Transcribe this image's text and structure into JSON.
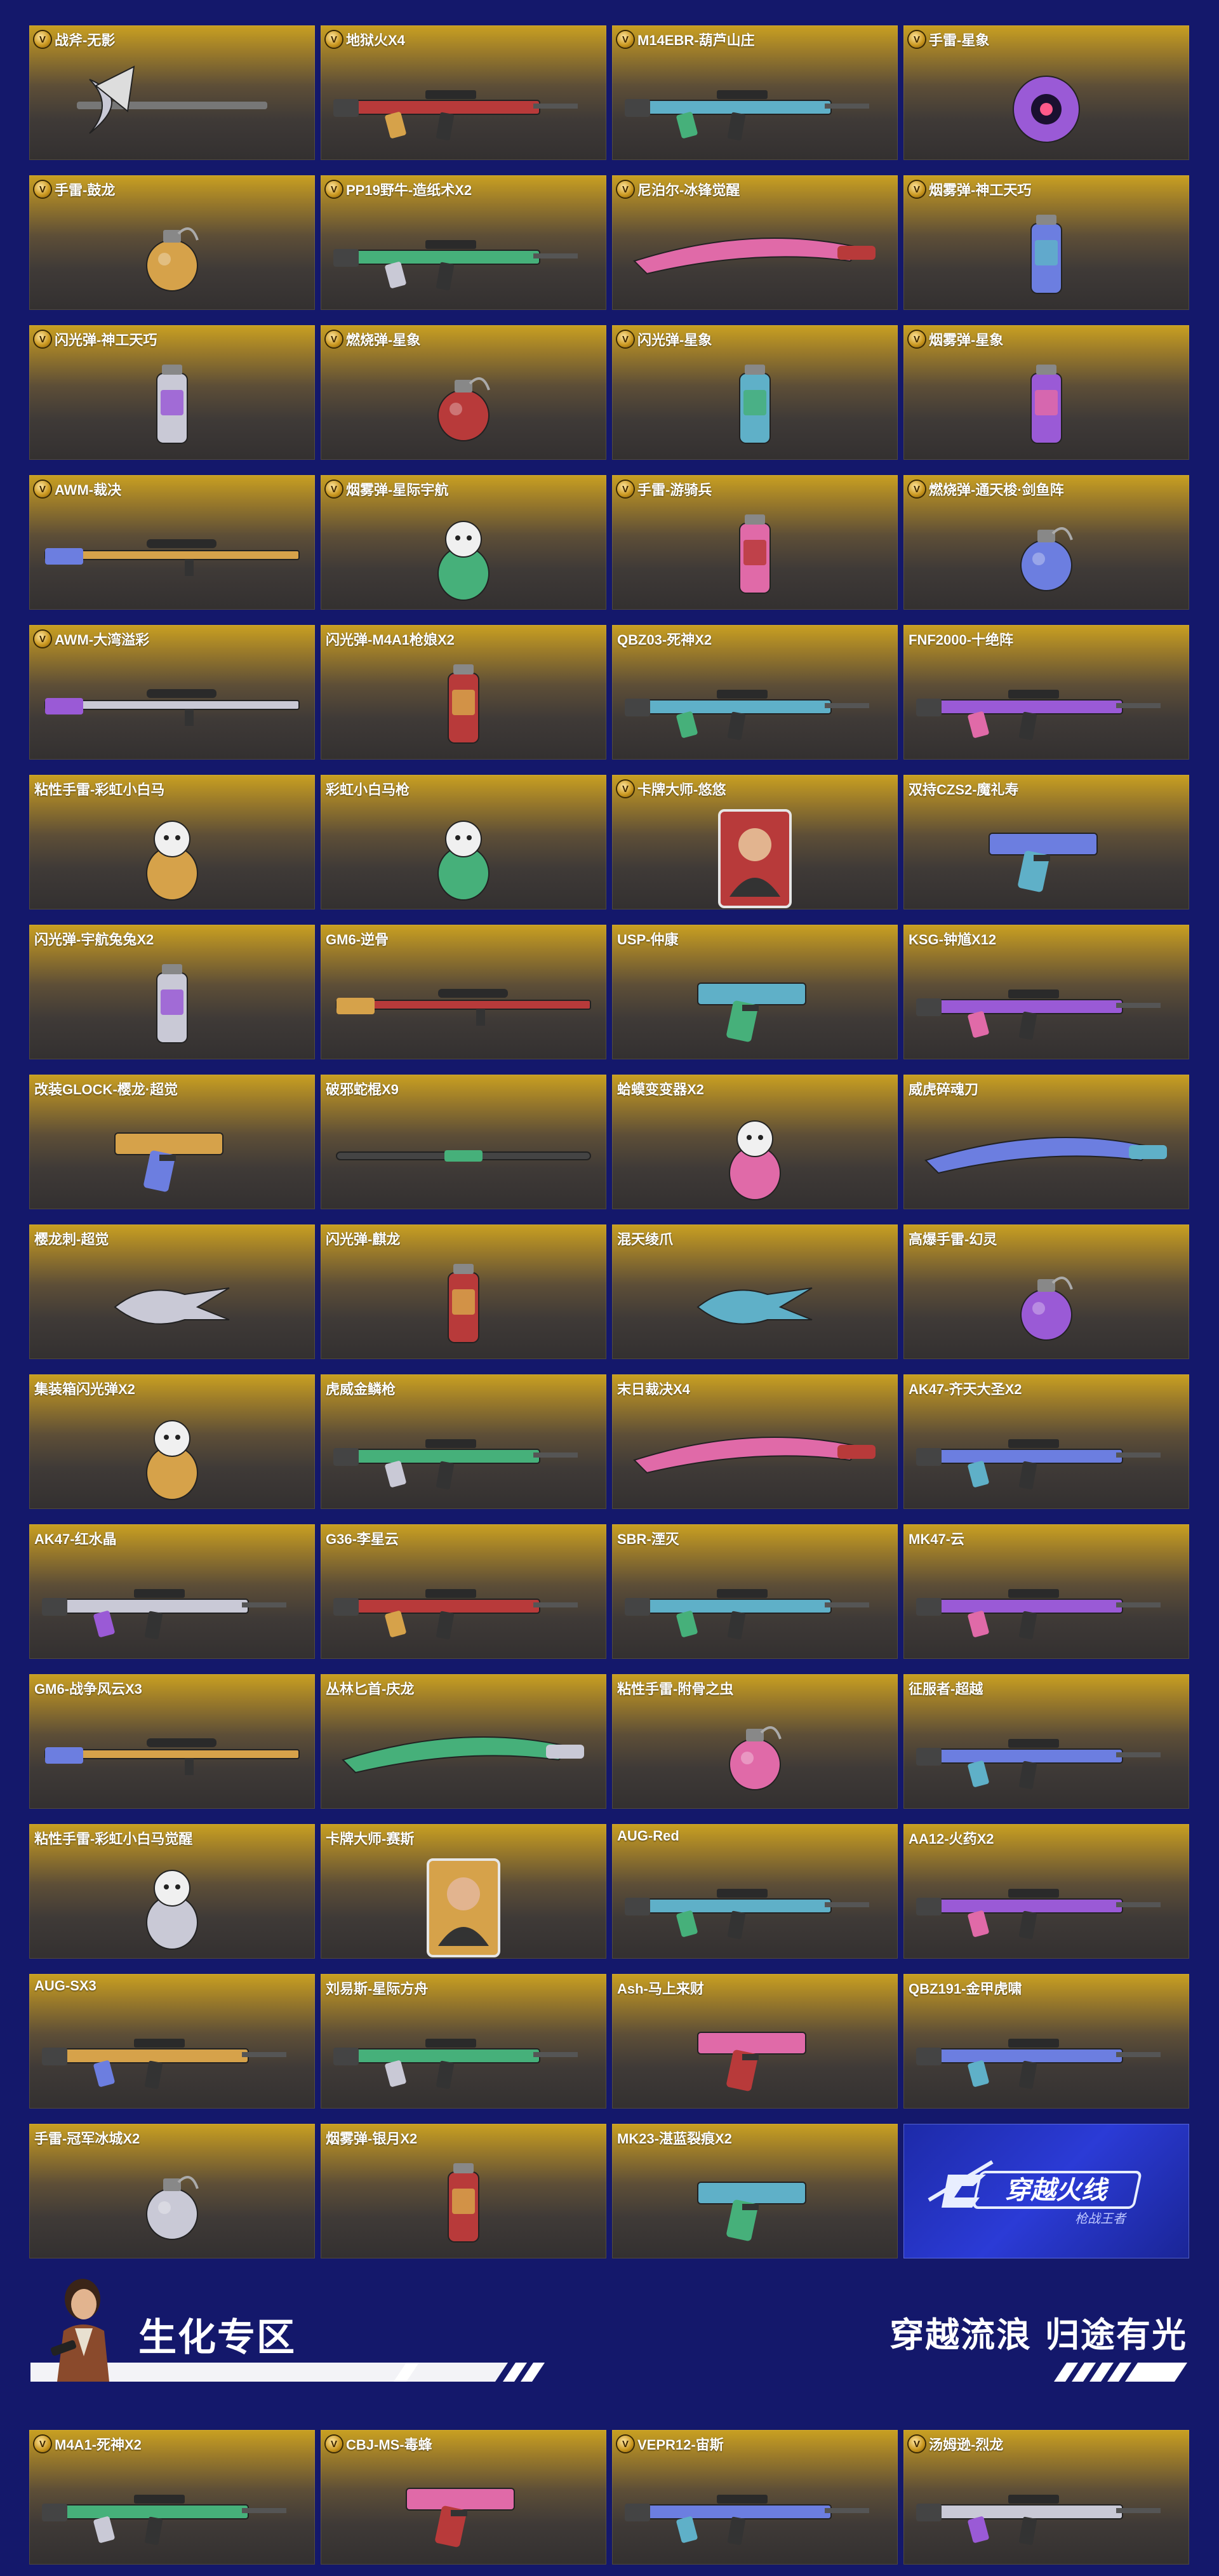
{
  "colors": {
    "background": "#14186b",
    "card_gold": "#c9a021",
    "card_dark": "#333030",
    "badge": "#c8951c"
  },
  "items": [
    {
      "name": "战斧-无影",
      "v": true,
      "icon": "axe"
    },
    {
      "name": "地狱火X4",
      "v": true,
      "icon": "rifle"
    },
    {
      "name": "M14EBR-葫芦山庄",
      "v": true,
      "icon": "rifle"
    },
    {
      "name": "手雷-星象",
      "v": true,
      "icon": "orb"
    },
    {
      "name": "手雷-鼓龙",
      "v": true,
      "icon": "grenade"
    },
    {
      "name": "PP19野牛-造纸术X2",
      "v": true,
      "icon": "rifle"
    },
    {
      "name": "尼泊尔-冰锋觉醒",
      "v": true,
      "icon": "knife"
    },
    {
      "name": "烟雾弹-神工天巧",
      "v": true,
      "icon": "canister"
    },
    {
      "name": "闪光弹-神工天巧",
      "v": true,
      "icon": "canister"
    },
    {
      "name": "燃烧弹-星象",
      "v": true,
      "icon": "grenade"
    },
    {
      "name": "闪光弹-星象",
      "v": true,
      "icon": "canister"
    },
    {
      "name": "烟雾弹-星象",
      "v": true,
      "icon": "canister"
    },
    {
      "name": "AWM-裁决",
      "v": true,
      "icon": "sniper"
    },
    {
      "name": "烟雾弹-星际宇航",
      "v": true,
      "icon": "figure"
    },
    {
      "name": "手雷-游骑兵",
      "v": true,
      "icon": "canister"
    },
    {
      "name": "燃烧弹-通天梭·剑鱼阵",
      "v": true,
      "icon": "grenade"
    },
    {
      "name": "AWM-大湾溢彩",
      "v": true,
      "icon": "sniper"
    },
    {
      "name": "闪光弹-M4A1枪娘X2",
      "v": false,
      "icon": "canister"
    },
    {
      "name": "QBZ03-死神X2",
      "v": false,
      "icon": "rifle"
    },
    {
      "name": "FNF2000-十绝阵",
      "v": false,
      "icon": "rifle"
    },
    {
      "name": "粘性手雷-彩虹小白马",
      "v": false,
      "icon": "figure"
    },
    {
      "name": "彩虹小白马枪",
      "v": false,
      "icon": "figure"
    },
    {
      "name": "卡牌大师-悠悠",
      "v": true,
      "icon": "card"
    },
    {
      "name": "双持CZS2-魔礼寿",
      "v": false,
      "icon": "pistol"
    },
    {
      "name": "闪光弹-宇航兔兔X2",
      "v": false,
      "icon": "canister"
    },
    {
      "name": "GM6-逆骨",
      "v": false,
      "icon": "sniper"
    },
    {
      "name": "USP-仲康",
      "v": false,
      "icon": "pistol"
    },
    {
      "name": "KSG-钟馗X12",
      "v": false,
      "icon": "rifle"
    },
    {
      "name": "改装GLOCK-樱龙·超觉",
      "v": false,
      "icon": "pistol"
    },
    {
      "name": "破邪蛇棍X9",
      "v": false,
      "icon": "staff"
    },
    {
      "name": "蛤蟆变变器X2",
      "v": false,
      "icon": "figure"
    },
    {
      "name": "威虎碎魂刀",
      "v": false,
      "icon": "knife"
    },
    {
      "name": "樱龙刺-超觉",
      "v": false,
      "icon": "claw"
    },
    {
      "name": "闪光弹-麒龙",
      "v": false,
      "icon": "canister"
    },
    {
      "name": "混天绫爪",
      "v": false,
      "icon": "claw"
    },
    {
      "name": "高爆手雷-幻灵",
      "v": false,
      "icon": "grenade"
    },
    {
      "name": "集装箱闪光弹X2",
      "v": false,
      "icon": "figure"
    },
    {
      "name": "虎威金鳞枪",
      "v": false,
      "icon": "rifle"
    },
    {
      "name": "末日裁决X4",
      "v": false,
      "icon": "knife"
    },
    {
      "name": "AK47-齐天大圣X2",
      "v": false,
      "icon": "rifle"
    },
    {
      "name": "AK47-红水晶",
      "v": false,
      "icon": "rifle"
    },
    {
      "name": "G36-李星云",
      "v": false,
      "icon": "rifle"
    },
    {
      "name": "SBR-湮灭",
      "v": false,
      "icon": "rifle"
    },
    {
      "name": "MK47-云",
      "v": false,
      "icon": "rifle"
    },
    {
      "name": "GM6-战争风云X3",
      "v": false,
      "icon": "sniper"
    },
    {
      "name": "丛林匕首-庆龙",
      "v": false,
      "icon": "knife"
    },
    {
      "name": "粘性手雷-附骨之虫",
      "v": false,
      "icon": "grenade"
    },
    {
      "name": "征服者-超越",
      "v": false,
      "icon": "rifle"
    },
    {
      "name": "粘性手雷-彩虹小白马觉醒",
      "v": false,
      "icon": "figure"
    },
    {
      "name": "卡牌大师-赛斯",
      "v": false,
      "icon": "card"
    },
    {
      "name": "AUG-Red",
      "v": false,
      "icon": "rifle"
    },
    {
      "name": "AA12-火药X2",
      "v": false,
      "icon": "rifle"
    },
    {
      "name": "AUG-SX3",
      "v": false,
      "icon": "rifle"
    },
    {
      "name": "刘易斯-星际方舟",
      "v": false,
      "icon": "rifle"
    },
    {
      "name": "Ash-马上来财",
      "v": false,
      "icon": "pistol"
    },
    {
      "name": "QBZ191-金甲虎啸",
      "v": false,
      "icon": "rifle"
    },
    {
      "name": "手雷-冠军冰城X2",
      "v": false,
      "icon": "grenade"
    },
    {
      "name": "烟雾弹-银月X2",
      "v": false,
      "icon": "canister"
    },
    {
      "name": "MK23-湛蓝裂痕X2",
      "v": false,
      "icon": "pistol"
    },
    {
      "name": "",
      "v": false,
      "icon": "logo",
      "logo_text": "穿越火线",
      "logo_sub": "枪战王者"
    }
  ],
  "banner": {
    "title": "生化专区",
    "slogan": "穿越流浪 归途有光"
  },
  "items2": [
    {
      "name": "M4A1-死神X2",
      "v": true,
      "icon": "rifle"
    },
    {
      "name": "CBJ-MS-毒蜂",
      "v": true,
      "icon": "pistol"
    },
    {
      "name": "VEPR12-宙斯",
      "v": true,
      "icon": "rifle"
    },
    {
      "name": "汤姆逊-烈龙",
      "v": true,
      "icon": "rifle"
    }
  ]
}
